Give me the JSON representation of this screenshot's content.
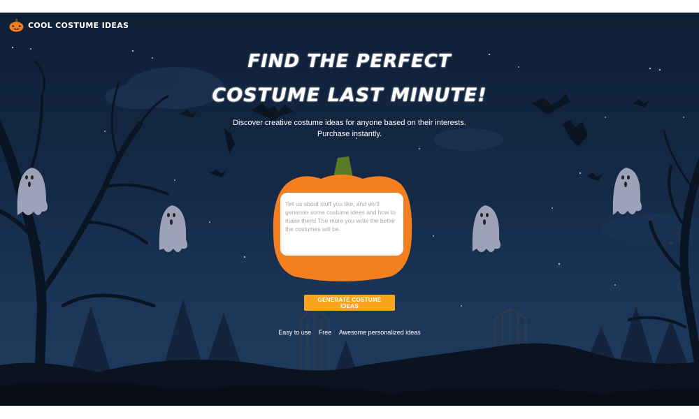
{
  "brand": {
    "name": "COOL COSTUME IDEAS",
    "icon": "pumpkin-icon"
  },
  "hero": {
    "title_line1": "FIND THE PERFECT",
    "title_line2": "COSTUME LAST MINUTE!",
    "subtitle": "Discover creative costume ideas for anyone based on their interests. Purchase instantly."
  },
  "form": {
    "placeholder": "Tell us about stuff you like, and we'll generate some costume ideas and how to make them! The more you write the better the costumes will be.",
    "value": "",
    "button_label": "GENERATE COSTUME IDEAS"
  },
  "features": [
    "Easy to use",
    "Free",
    "Awesome personalized ideas"
  ],
  "colors": {
    "accent": "#f8a41c",
    "pumpkin": "#f47f1e",
    "stem": "#5a7a24",
    "sky": "#142a47"
  }
}
